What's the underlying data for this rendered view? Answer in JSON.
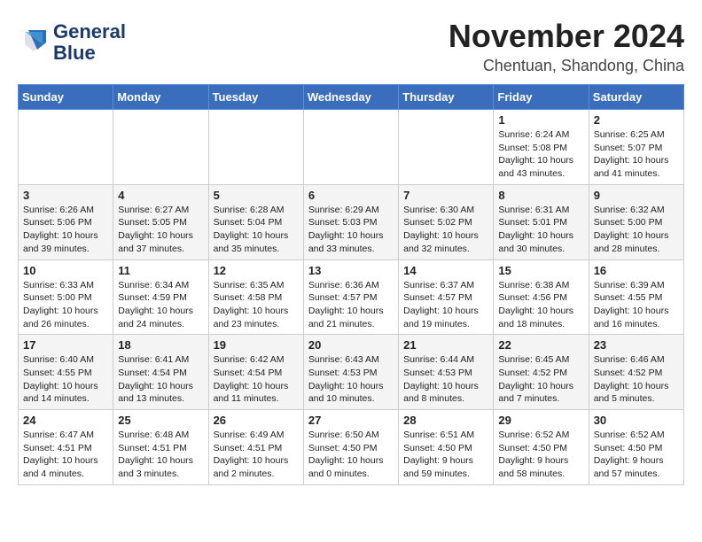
{
  "header": {
    "logo_line1": "General",
    "logo_line2": "Blue",
    "month": "November 2024",
    "location": "Chentuan, Shandong, China"
  },
  "weekdays": [
    "Sunday",
    "Monday",
    "Tuesday",
    "Wednesday",
    "Thursday",
    "Friday",
    "Saturday"
  ],
  "weeks": [
    [
      {
        "day": "",
        "info": ""
      },
      {
        "day": "",
        "info": ""
      },
      {
        "day": "",
        "info": ""
      },
      {
        "day": "",
        "info": ""
      },
      {
        "day": "",
        "info": ""
      },
      {
        "day": "1",
        "info": "Sunrise: 6:24 AM\nSunset: 5:08 PM\nDaylight: 10 hours\nand 43 minutes."
      },
      {
        "day": "2",
        "info": "Sunrise: 6:25 AM\nSunset: 5:07 PM\nDaylight: 10 hours\nand 41 minutes."
      }
    ],
    [
      {
        "day": "3",
        "info": "Sunrise: 6:26 AM\nSunset: 5:06 PM\nDaylight: 10 hours\nand 39 minutes."
      },
      {
        "day": "4",
        "info": "Sunrise: 6:27 AM\nSunset: 5:05 PM\nDaylight: 10 hours\nand 37 minutes."
      },
      {
        "day": "5",
        "info": "Sunrise: 6:28 AM\nSunset: 5:04 PM\nDaylight: 10 hours\nand 35 minutes."
      },
      {
        "day": "6",
        "info": "Sunrise: 6:29 AM\nSunset: 5:03 PM\nDaylight: 10 hours\nand 33 minutes."
      },
      {
        "day": "7",
        "info": "Sunrise: 6:30 AM\nSunset: 5:02 PM\nDaylight: 10 hours\nand 32 minutes."
      },
      {
        "day": "8",
        "info": "Sunrise: 6:31 AM\nSunset: 5:01 PM\nDaylight: 10 hours\nand 30 minutes."
      },
      {
        "day": "9",
        "info": "Sunrise: 6:32 AM\nSunset: 5:00 PM\nDaylight: 10 hours\nand 28 minutes."
      }
    ],
    [
      {
        "day": "10",
        "info": "Sunrise: 6:33 AM\nSunset: 5:00 PM\nDaylight: 10 hours\nand 26 minutes."
      },
      {
        "day": "11",
        "info": "Sunrise: 6:34 AM\nSunset: 4:59 PM\nDaylight: 10 hours\nand 24 minutes."
      },
      {
        "day": "12",
        "info": "Sunrise: 6:35 AM\nSunset: 4:58 PM\nDaylight: 10 hours\nand 23 minutes."
      },
      {
        "day": "13",
        "info": "Sunrise: 6:36 AM\nSunset: 4:57 PM\nDaylight: 10 hours\nand 21 minutes."
      },
      {
        "day": "14",
        "info": "Sunrise: 6:37 AM\nSunset: 4:57 PM\nDaylight: 10 hours\nand 19 minutes."
      },
      {
        "day": "15",
        "info": "Sunrise: 6:38 AM\nSunset: 4:56 PM\nDaylight: 10 hours\nand 18 minutes."
      },
      {
        "day": "16",
        "info": "Sunrise: 6:39 AM\nSunset: 4:55 PM\nDaylight: 10 hours\nand 16 minutes."
      }
    ],
    [
      {
        "day": "17",
        "info": "Sunrise: 6:40 AM\nSunset: 4:55 PM\nDaylight: 10 hours\nand 14 minutes."
      },
      {
        "day": "18",
        "info": "Sunrise: 6:41 AM\nSunset: 4:54 PM\nDaylight: 10 hours\nand 13 minutes."
      },
      {
        "day": "19",
        "info": "Sunrise: 6:42 AM\nSunset: 4:54 PM\nDaylight: 10 hours\nand 11 minutes."
      },
      {
        "day": "20",
        "info": "Sunrise: 6:43 AM\nSunset: 4:53 PM\nDaylight: 10 hours\nand 10 minutes."
      },
      {
        "day": "21",
        "info": "Sunrise: 6:44 AM\nSunset: 4:53 PM\nDaylight: 10 hours\nand 8 minutes."
      },
      {
        "day": "22",
        "info": "Sunrise: 6:45 AM\nSunset: 4:52 PM\nDaylight: 10 hours\nand 7 minutes."
      },
      {
        "day": "23",
        "info": "Sunrise: 6:46 AM\nSunset: 4:52 PM\nDaylight: 10 hours\nand 5 minutes."
      }
    ],
    [
      {
        "day": "24",
        "info": "Sunrise: 6:47 AM\nSunset: 4:51 PM\nDaylight: 10 hours\nand 4 minutes."
      },
      {
        "day": "25",
        "info": "Sunrise: 6:48 AM\nSunset: 4:51 PM\nDaylight: 10 hours\nand 3 minutes."
      },
      {
        "day": "26",
        "info": "Sunrise: 6:49 AM\nSunset: 4:51 PM\nDaylight: 10 hours\nand 2 minutes."
      },
      {
        "day": "27",
        "info": "Sunrise: 6:50 AM\nSunset: 4:50 PM\nDaylight: 10 hours\nand 0 minutes."
      },
      {
        "day": "28",
        "info": "Sunrise: 6:51 AM\nSunset: 4:50 PM\nDaylight: 9 hours\nand 59 minutes."
      },
      {
        "day": "29",
        "info": "Sunrise: 6:52 AM\nSunset: 4:50 PM\nDaylight: 9 hours\nand 58 minutes."
      },
      {
        "day": "30",
        "info": "Sunrise: 6:52 AM\nSunset: 4:50 PM\nDaylight: 9 hours\nand 57 minutes."
      }
    ]
  ]
}
